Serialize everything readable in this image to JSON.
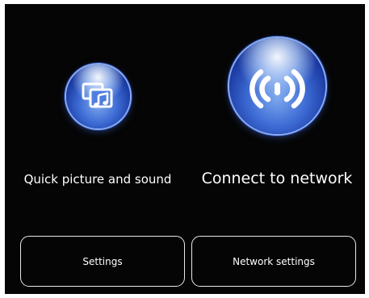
{
  "options": {
    "quick": {
      "label": "Quick picture and sound",
      "icon": "picture-music-icon"
    },
    "network": {
      "label": "Connect to network",
      "icon": "wireless-signal-icon"
    }
  },
  "buttons": {
    "settings": "Settings",
    "network_settings": "Network settings"
  },
  "colors": {
    "background": "#050505",
    "orb": "#3d6bd4",
    "text": "#ffffff",
    "button_border": "#e8e8e8"
  }
}
